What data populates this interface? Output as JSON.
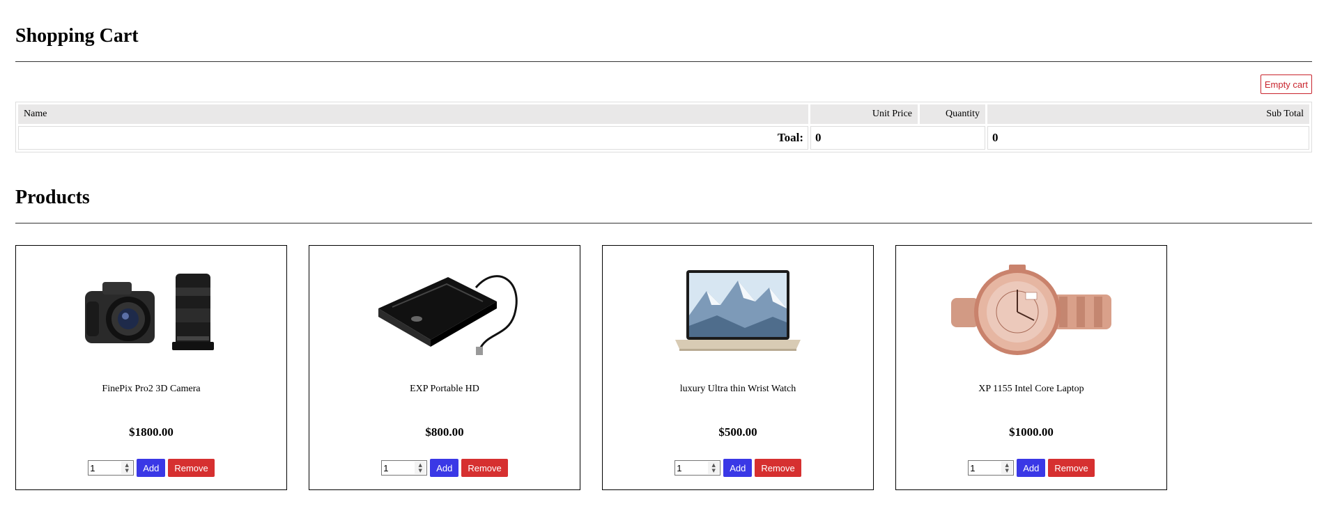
{
  "cart": {
    "title": "Shopping Cart",
    "empty_button": "Empty cart",
    "columns": [
      "Name",
      "Unit Price",
      "Quantity",
      "Sub Total"
    ],
    "total_label": "Toal:",
    "total_quantity": "0",
    "total_amount": "0"
  },
  "products": {
    "title": "Products",
    "items": [
      {
        "name": "FinePix Pro2 3D Camera",
        "price": "$1800.00",
        "quantity": "1",
        "add_label": "Add",
        "remove_label": "Remove",
        "icon": "camera-image"
      },
      {
        "name": "EXP Portable HD",
        "price": "$800.00",
        "quantity": "1",
        "add_label": "Add",
        "remove_label": "Remove",
        "icon": "hard-drive-image"
      },
      {
        "name": "luxury Ultra thin Wrist Watch",
        "price": "$500.00",
        "quantity": "1",
        "add_label": "Add",
        "remove_label": "Remove",
        "icon": "laptop-image"
      },
      {
        "name": "XP 1155 Intel Core Laptop",
        "price": "$1000.00",
        "quantity": "1",
        "add_label": "Add",
        "remove_label": "Remove",
        "icon": "watch-image"
      }
    ]
  },
  "colors": {
    "add_button": "#3a38e6",
    "remove_button": "#d63030",
    "empty_cart_border": "#c8232c",
    "table_header_bg": "#e9e8e8"
  }
}
